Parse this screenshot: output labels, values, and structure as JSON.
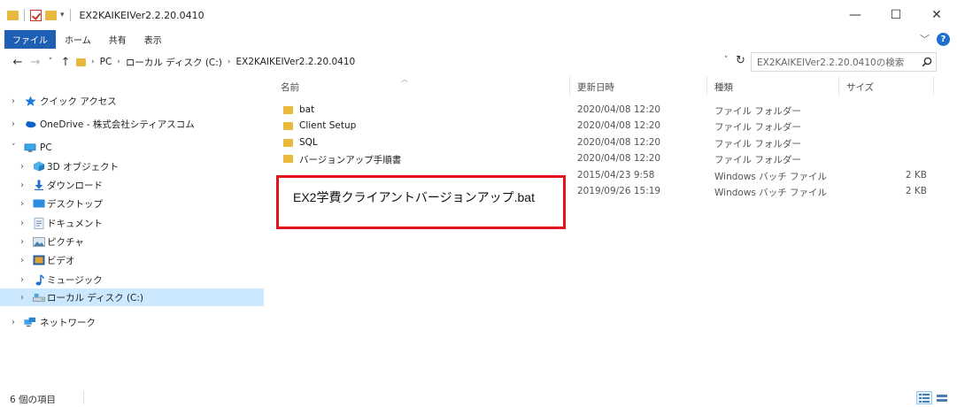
{
  "window": {
    "title": "EX2KAIKEIVer2.2.20.0410",
    "controls": {
      "minimize": "—",
      "maximize": "☐",
      "close": "✕"
    }
  },
  "ribbon": {
    "tabs": [
      "ファイル",
      "ホーム",
      "共有",
      "表示"
    ],
    "help": "?"
  },
  "address": {
    "crumbs": [
      "PC",
      "ローカル ディスク (C:)",
      "EX2KAIKEIVer2.2.20.0410"
    ],
    "search_placeholder": "EX2KAIKEIVer2.2.20.0410の検索"
  },
  "nav": {
    "items": [
      {
        "label": "クイック アクセス",
        "icon": "star-icon",
        "expanded": false
      },
      {
        "label": "OneDrive - 株式会社シティアスコム",
        "icon": "cloud-icon",
        "expanded": false
      },
      {
        "label": "PC",
        "icon": "pc-icon",
        "expanded": true
      },
      {
        "label": "3D オブジェクト",
        "icon": "cube-icon",
        "expanded": false
      },
      {
        "label": "ダウンロード",
        "icon": "download-icon",
        "expanded": false
      },
      {
        "label": "デスクトップ",
        "icon": "desktop-icon",
        "expanded": false
      },
      {
        "label": "ドキュメント",
        "icon": "document-icon",
        "expanded": false
      },
      {
        "label": "ピクチャ",
        "icon": "picture-icon",
        "expanded": false
      },
      {
        "label": "ビデオ",
        "icon": "video-icon",
        "expanded": false
      },
      {
        "label": "ミュージック",
        "icon": "music-icon",
        "expanded": false
      },
      {
        "label": "ローカル ディスク (C:)",
        "icon": "drive-icon",
        "expanded": false,
        "selected": true
      },
      {
        "label": "ネットワーク",
        "icon": "network-icon",
        "expanded": false
      }
    ]
  },
  "columns": {
    "name": "名前",
    "date": "更新日時",
    "type": "種類",
    "size": "サイズ"
  },
  "files": [
    {
      "name": "bat",
      "date": "2020/04/08 12:20",
      "type": "ファイル フォルダー",
      "size": ""
    },
    {
      "name": "Client Setup",
      "date": "2020/04/08 12:20",
      "type": "ファイル フォルダー",
      "size": ""
    },
    {
      "name": "SQL",
      "date": "2020/04/08 12:20",
      "type": "ファイル フォルダー",
      "size": ""
    },
    {
      "name": "バージョンアップ手順書",
      "date": "2020/04/08 12:20",
      "type": "ファイル フォルダー",
      "size": ""
    },
    {
      "name": "",
      "date": "2015/04/23 9:58",
      "type": "Windows バッチ ファイル",
      "size": "2 KB"
    },
    {
      "name": "",
      "date": "2019/09/26 15:19",
      "type": "Windows バッチ ファイル",
      "size": "2 KB"
    }
  ],
  "highlight": {
    "text": "EX2学費クライアントバージョンアップ.bat",
    "color": "#e0141a"
  },
  "status": {
    "count": "6 個の項目"
  },
  "colors": {
    "accent": "#1e5fb3",
    "folder": "#e8b93c",
    "selected_bg": "#cce8ff"
  }
}
